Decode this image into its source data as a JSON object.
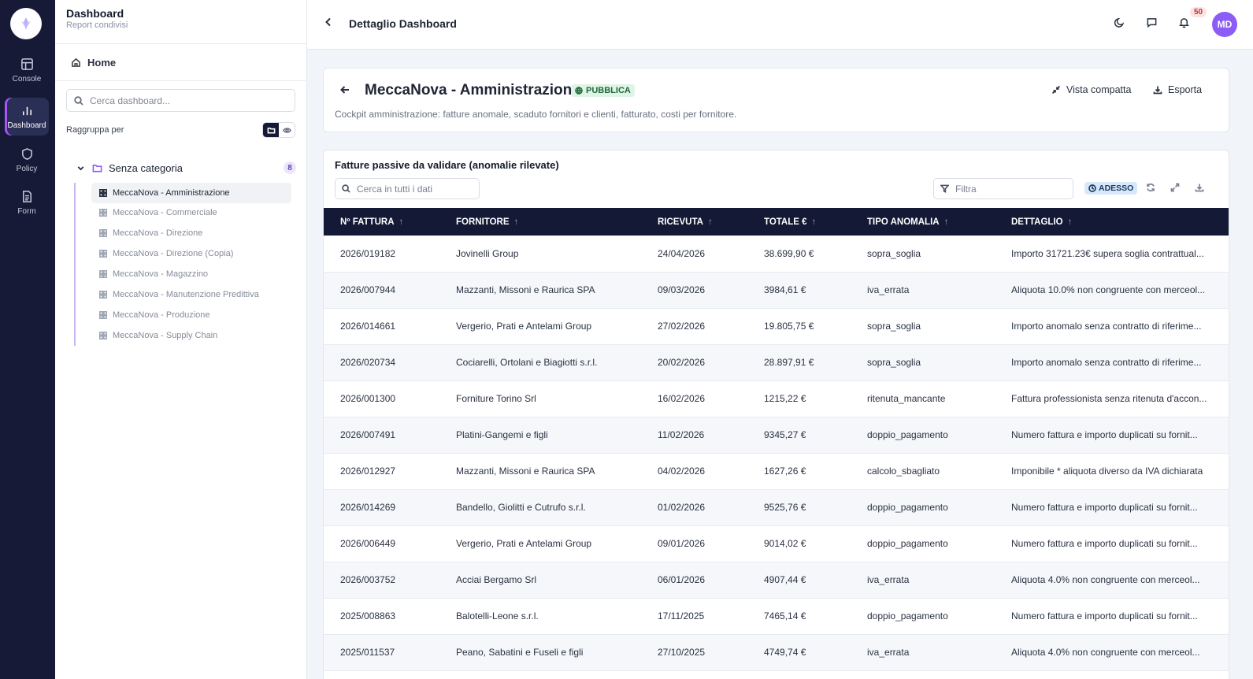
{
  "rail": {
    "items": [
      {
        "label": "Console",
        "icon": "layout-icon"
      },
      {
        "label": "Dashboard",
        "icon": "bar-chart-icon"
      },
      {
        "label": "Policy",
        "icon": "shield-icon"
      },
      {
        "label": "Form",
        "icon": "document-icon"
      }
    ]
  },
  "sidebar": {
    "title": "Dashboard",
    "subtitle": "Report condivisi",
    "home_label": "Home",
    "search_placeholder": "Cerca dashboard...",
    "group_by_label": "Raggruppa per",
    "category": {
      "label": "Senza categoria",
      "count": "8"
    },
    "items": [
      "MeccaNova - Amministrazione",
      "MeccaNova - Commerciale",
      "MeccaNova - Direzione",
      "MeccaNova - Direzione (Copia)",
      "MeccaNova - Magazzino",
      "MeccaNova - Manutenzione Predittiva",
      "MeccaNova - Produzione",
      "MeccaNova - Supply Chain"
    ]
  },
  "topbar": {
    "title": "Dettaglio Dashboard",
    "notification_count": "50",
    "avatar_initials": "MD"
  },
  "header": {
    "title": "MeccaNova - Amministrazione",
    "visibility_badge": "PUBBLICA",
    "description": "Cockpit amministrazione: fatture anomale, scaduto fornitori e clienti, fatturato, costi per fornitore.",
    "compact_label": "Vista compatta",
    "export_label": "Esporta"
  },
  "table": {
    "title": "Fatture passive da validare (anomalie rilevate)",
    "search_placeholder": "Cerca in tutti i dati",
    "filter_placeholder": "Filtra",
    "now_badge": "ADESSO",
    "columns": [
      "Nº FATTURA",
      "FORNITORE",
      "RICEVUTA",
      "TOTALE €",
      "TIPO ANOMALIA",
      "DETTAGLIO"
    ],
    "rows": [
      [
        "2026/019182",
        "Jovinelli Group",
        "24/04/2026",
        "38.699,90 €",
        "sopra_soglia",
        "Importo 31721.23€ supera soglia contrattual..."
      ],
      [
        "2026/007944",
        "Mazzanti, Missoni e Raurica SPA",
        "09/03/2026",
        "3984,61 €",
        "iva_errata",
        "Aliquota 10.0% non congruente con merceol..."
      ],
      [
        "2026/014661",
        "Vergerio, Prati e Antelami Group",
        "27/02/2026",
        "19.805,75 €",
        "sopra_soglia",
        "Importo anomalo senza contratto di riferime..."
      ],
      [
        "2026/020734",
        "Cociarelli, Ortolani e Biagiotti s.r.l.",
        "20/02/2026",
        "28.897,91 €",
        "sopra_soglia",
        "Importo anomalo senza contratto di riferime..."
      ],
      [
        "2026/001300",
        "Forniture Torino Srl",
        "16/02/2026",
        "1215,22 €",
        "ritenuta_mancante",
        "Fattura professionista senza ritenuta d'accon..."
      ],
      [
        "2026/007491",
        "Platini-Gangemi e figli",
        "11/02/2026",
        "9345,27 €",
        "doppio_pagamento",
        "Numero fattura e importo duplicati su fornit..."
      ],
      [
        "2026/012927",
        "Mazzanti, Missoni e Raurica SPA",
        "04/02/2026",
        "1627,26 €",
        "calcolo_sbagliato",
        "Imponibile * aliquota diverso da IVA dichiarata"
      ],
      [
        "2026/014269",
        "Bandello, Giolitti e Cutrufo s.r.l.",
        "01/02/2026",
        "9525,76 €",
        "doppio_pagamento",
        "Numero fattura e importo duplicati su fornit..."
      ],
      [
        "2026/006449",
        "Vergerio, Prati e Antelami Group",
        "09/01/2026",
        "9014,02 €",
        "doppio_pagamento",
        "Numero fattura e importo duplicati su fornit..."
      ],
      [
        "2026/003752",
        "Acciai Bergamo Srl",
        "06/01/2026",
        "4907,44 €",
        "iva_errata",
        "Aliquota 4.0% non congruente con merceol..."
      ],
      [
        "2025/008863",
        "Balotelli-Leone s.r.l.",
        "17/11/2025",
        "7465,14 €",
        "doppio_pagamento",
        "Numero fattura e importo duplicati su fornit..."
      ],
      [
        "2025/011537",
        "Peano, Sabatini e Fuseli e figli",
        "27/10/2025",
        "4749,74 €",
        "iva_errata",
        "Aliquota 4.0% non congruente con merceol..."
      ]
    ]
  }
}
